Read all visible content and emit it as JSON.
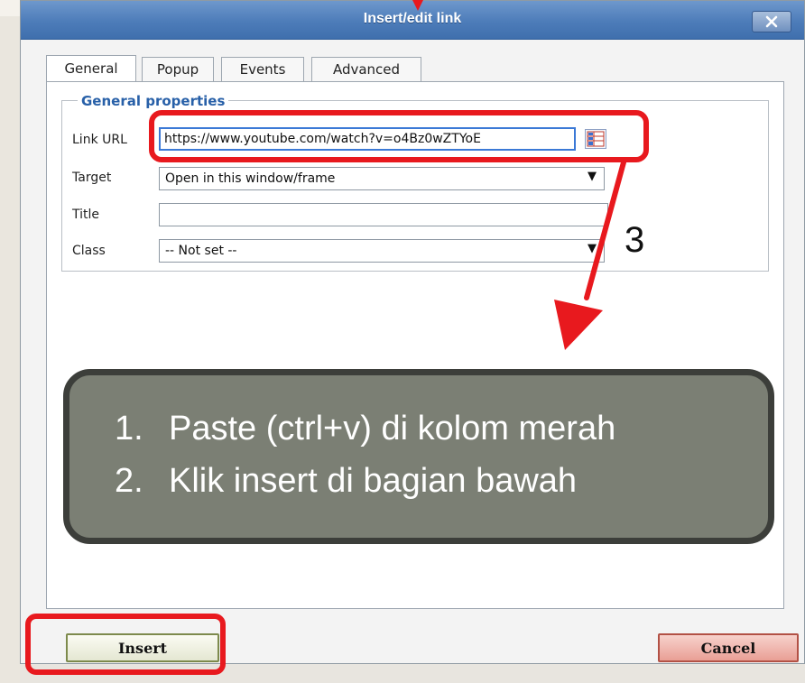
{
  "dialog": {
    "title": "Insert/edit link",
    "close_icon": "close-x-icon"
  },
  "tabs": [
    {
      "label": "General",
      "active": true
    },
    {
      "label": "Popup",
      "active": false
    },
    {
      "label": "Events",
      "active": false
    },
    {
      "label": "Advanced",
      "active": false
    }
  ],
  "general_properties": {
    "legend": "General properties",
    "link_url": {
      "label": "Link URL",
      "value": "https://www.youtube.com/watch?v=o4Bz0wZTYoE",
      "browse_icon": "browse-list-icon"
    },
    "target": {
      "label": "Target",
      "value": "Open in this window/frame"
    },
    "title": {
      "label": "Title",
      "value": ""
    },
    "class": {
      "label": "Class",
      "value": "-- Not set --"
    }
  },
  "annotation": {
    "step_number": "3",
    "instructions": [
      {
        "number": "1.",
        "text": "Paste (ctrl+v) di kolom merah"
      },
      {
        "number": "2.",
        "text": "Klik insert di bagian bawah"
      }
    ],
    "highlight_color": "#e8191e",
    "callout_color": "#7b7f74"
  },
  "buttons": {
    "insert": "Insert",
    "cancel": "Cancel"
  },
  "select_arrow": "▼"
}
